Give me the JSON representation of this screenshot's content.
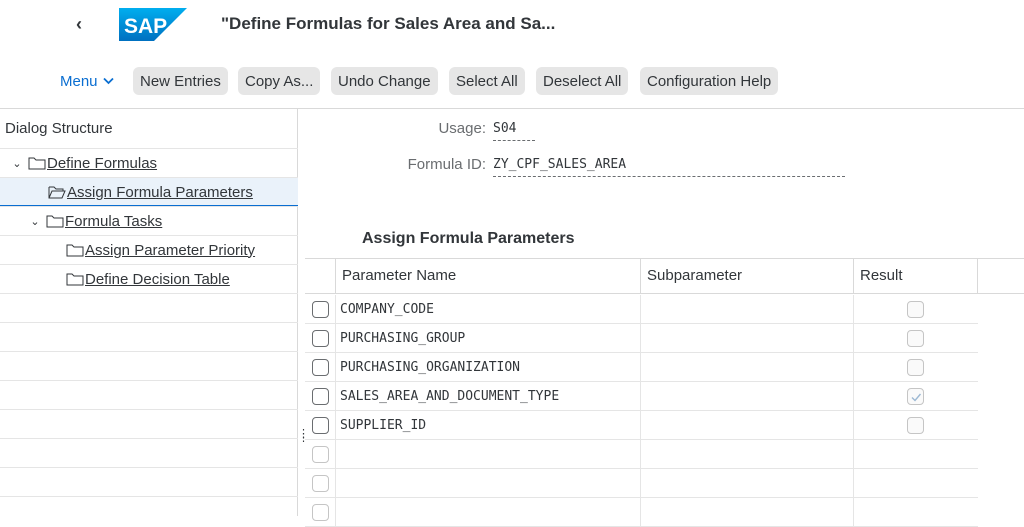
{
  "header": {
    "title": "\"Define Formulas for Sales Area and Sa...",
    "logo_text": "SAP",
    "brand_color": "#0a6ed1"
  },
  "toolbar": {
    "menu_label": "Menu",
    "buttons": [
      "New Entries",
      "Copy As...",
      "Undo Change",
      "Select All",
      "Deselect All",
      "Configuration Help"
    ]
  },
  "dialog_structure": {
    "title": "Dialog Structure",
    "items": [
      {
        "label": "Define Formulas",
        "expanded": true
      },
      {
        "label": "Assign Formula Parameters",
        "selected": true
      },
      {
        "label": "Formula Tasks",
        "expanded": true
      },
      {
        "label": "Assign Parameter Priority"
      },
      {
        "label": "Define Decision Table"
      }
    ]
  },
  "fields": {
    "usage_label": "Usage:",
    "usage_value": "S04",
    "formula_id_label": "Formula ID:",
    "formula_id_value": "ZY_CPF_SALES_AREA"
  },
  "section": {
    "title": "Assign Formula Parameters",
    "columns": [
      "Parameter Name",
      "Subparameter",
      "Result"
    ],
    "rows": [
      {
        "parameter": "COMPANY_CODE",
        "subparameter": "",
        "result": false
      },
      {
        "parameter": "PURCHASING_GROUP",
        "subparameter": "",
        "result": false
      },
      {
        "parameter": "PURCHASING_ORGANIZATION",
        "subparameter": "",
        "result": false
      },
      {
        "parameter": "SALES_AREA_AND_DOCUMENT_TYPE",
        "subparameter": "",
        "result": true
      },
      {
        "parameter": "SUPPLIER_ID",
        "subparameter": "",
        "result": false
      }
    ]
  }
}
